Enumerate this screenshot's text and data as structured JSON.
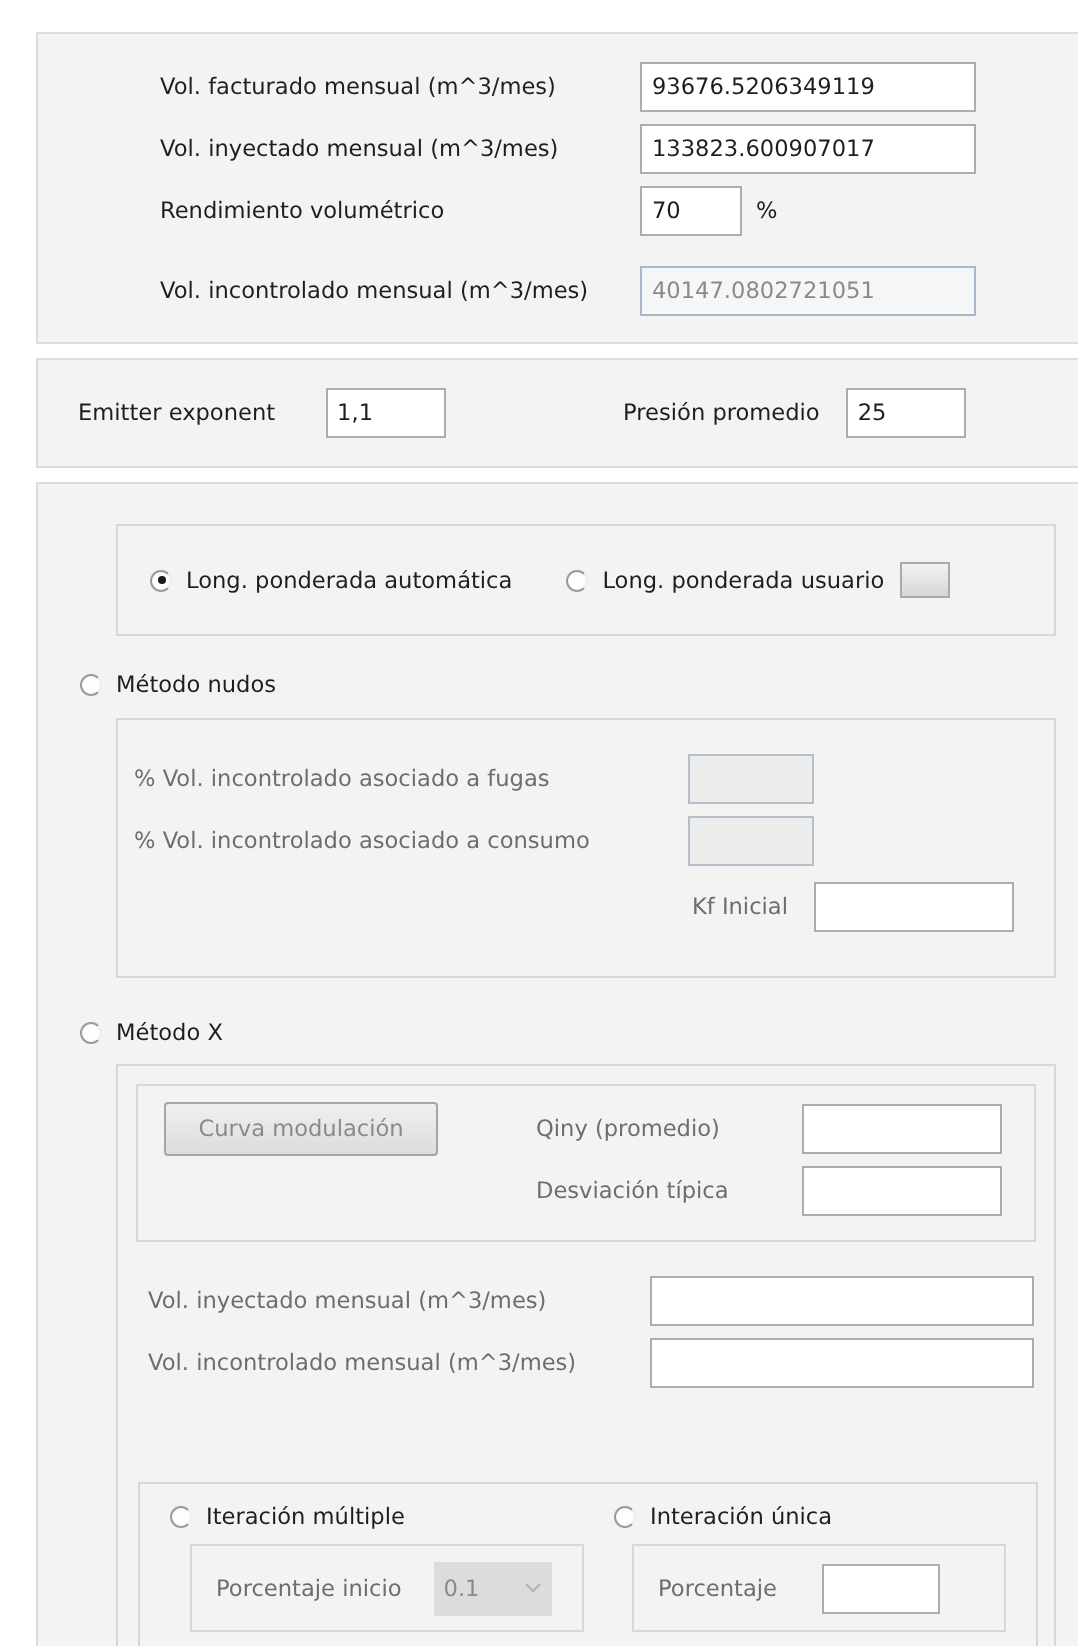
{
  "volumes": [
    {
      "label": "Vol. facturado mensual (m^3/mes)",
      "value": "93676.5206349119",
      "kind": "wide",
      "disabled": false
    },
    {
      "label": "Vol. inyectado mensual (m^3/mes)",
      "value": "133823.600907017",
      "kind": "wide",
      "disabled": false
    },
    {
      "label": "Rendimiento volumétrico",
      "value": "70",
      "unit": "%",
      "kind": "narrow",
      "disabled": false
    },
    {
      "label": "Vol. incontrolado mensual (m^3/mes)",
      "value": "40147.0802721051",
      "kind": "wide",
      "disabled": true
    }
  ],
  "emitter_exponent": {
    "label": "Emitter exponent",
    "value": "1,1"
  },
  "presion_promedio": {
    "label": "Presión promedio",
    "value": "25"
  },
  "weighting": [
    {
      "label": "Long. ponderada automática",
      "selected": true
    },
    {
      "label": "Long. ponderada usuario",
      "selected": false
    }
  ],
  "metodo_nudos": {
    "label": "Método nudos",
    "selected": false,
    "disabled": true,
    "fields": [
      {
        "label": "% Vol. incontrolado asociado a fugas",
        "disabled": true
      },
      {
        "label": "% Vol. incontrolado asociado a consumo",
        "disabled": true
      }
    ],
    "kf": {
      "label": "Kf Inicial",
      "disabled": false
    }
  },
  "metodo_x": {
    "label": "Método X",
    "selected": false,
    "disabled": true,
    "button": {
      "label": "Curva modulación",
      "disabled": true
    },
    "stats": [
      {
        "label": "Qiny (promedio)"
      },
      {
        "label": "Desviación típica"
      }
    ],
    "volumes": [
      {
        "label": "Vol. inyectado mensual (m^3/mes)"
      },
      {
        "label": "Vol. incontrolado mensual (m^3/mes)"
      }
    ],
    "iteration": [
      {
        "label": "Iteración múltiple",
        "selected": false,
        "field_label": "Porcentaje inicio",
        "kind": "combo",
        "value": "0.1"
      },
      {
        "label": "Interación única",
        "selected": false,
        "field_label": "Porcentaje",
        "kind": "input"
      }
    ]
  }
}
